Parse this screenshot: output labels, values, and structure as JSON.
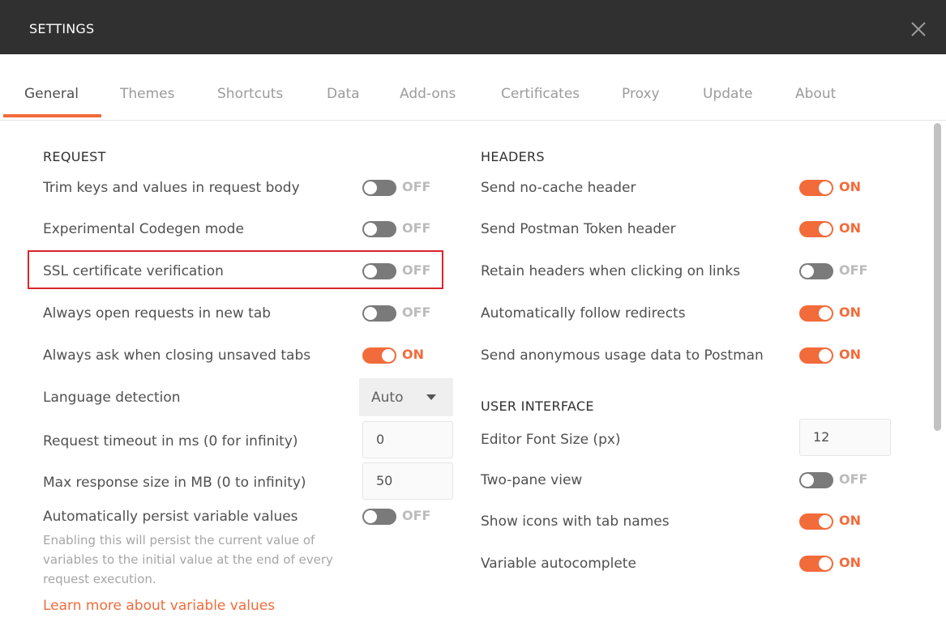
{
  "window": {
    "title": "SETTINGS"
  },
  "tabs": [
    {
      "label": "General",
      "active": true
    },
    {
      "label": "Themes"
    },
    {
      "label": "Shortcuts"
    },
    {
      "label": "Data"
    },
    {
      "label": "Add-ons"
    },
    {
      "label": "Certificates"
    },
    {
      "label": "Proxy"
    },
    {
      "label": "Update"
    },
    {
      "label": "About"
    }
  ],
  "request": {
    "title": "REQUEST",
    "trim_keys": {
      "label": "Trim keys and values in request body",
      "state": "OFF"
    },
    "codegen": {
      "label": "Experimental Codegen mode",
      "state": "OFF"
    },
    "ssl_verification": {
      "label": "SSL certificate verification",
      "state": "OFF"
    },
    "open_new_tab": {
      "label": "Always open requests in new tab",
      "state": "OFF"
    },
    "ask_closing": {
      "label": "Always ask when closing unsaved tabs",
      "state": "ON"
    },
    "language_detection": {
      "label": "Language detection",
      "value": "Auto"
    },
    "request_timeout": {
      "label": "Request timeout in ms (0 for infinity)",
      "value": "0"
    },
    "max_response": {
      "label": "Max response size in MB (0 to infinity)",
      "value": "50"
    },
    "persist_variables": {
      "label": "Automatically persist variable values",
      "state": "OFF",
      "help": "Enabling this will persist the current value of variables to the initial value at the end of every request execution.",
      "link": "Learn more about variable values"
    }
  },
  "headers": {
    "title": "HEADERS",
    "no_cache": {
      "label": "Send no-cache header",
      "state": "ON"
    },
    "postman_token": {
      "label": "Send Postman Token header",
      "state": "ON"
    },
    "retain_headers": {
      "label": "Retain headers when clicking on links",
      "state": "OFF"
    },
    "follow_redirects": {
      "label": "Automatically follow redirects",
      "state": "ON"
    },
    "anonymous_usage": {
      "label": "Send anonymous usage data to Postman",
      "state": "ON"
    }
  },
  "user_interface": {
    "title": "USER INTERFACE",
    "editor_font_size": {
      "label": "Editor Font Size (px)",
      "value": "12"
    },
    "two_pane": {
      "label": "Two-pane view",
      "state": "OFF"
    },
    "tab_icons": {
      "label": "Show icons with tab names",
      "state": "ON"
    },
    "variable_autocomplete": {
      "label": "Variable autocomplete",
      "state": "ON"
    }
  },
  "colors": {
    "accent": "#f26b3a",
    "titlebar": "#303030",
    "toggle_off": "#7a7a7a",
    "highlight": "#d9262c"
  }
}
